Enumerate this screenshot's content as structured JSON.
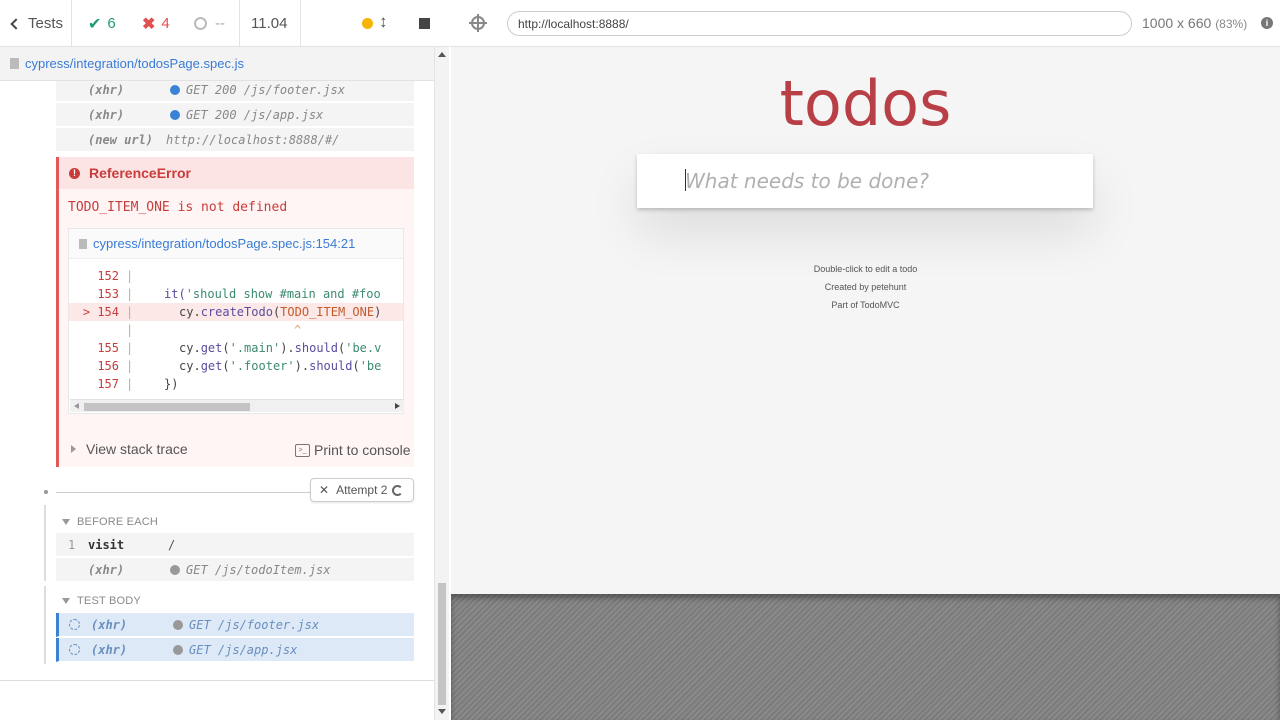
{
  "stats": {
    "back_label": "Tests",
    "passed": "6",
    "failed": "4",
    "pending": "--",
    "duration": "11.04"
  },
  "spec": {
    "path": "cypress/integration/todosPage.spec.js"
  },
  "commands_top": [
    {
      "type": "(xhr)",
      "msg": "GET 200 /js/footer.jsx"
    },
    {
      "type": "(xhr)",
      "msg": "GET 200 /js/app.jsx"
    },
    {
      "type": "(new url)",
      "msg": "http://localhost:8888/#/"
    }
  ],
  "error": {
    "name": "ReferenceError",
    "message": "TODO_ITEM_ONE is not defined",
    "file_link": "cypress/integration/todosPage.spec.js:154:21",
    "lines": {
      "l152": "152",
      "l153": "153",
      "l154": "> 154",
      "l155": "155",
      "l156": "156",
      "l157": "157"
    },
    "code": {
      "l153_a": "it(",
      "l153_b": "'should show #main and #foo",
      "l154_a": "cy.",
      "l154_b": "createTodo",
      "l154_c": "(",
      "l154_d": "TODO_ITEM_ONE",
      "l154_e": ")",
      "caret": "^",
      "l155_a": "cy.",
      "l155_b": "get",
      "l155_c": "(",
      "l155_d": "'.main'",
      "l155_e": ").",
      "l155_f": "should",
      "l155_g": "(",
      "l155_h": "'be.v",
      "l156_a": "cy.",
      "l156_b": "get",
      "l156_c": "(",
      "l156_d": "'.footer'",
      "l156_e": ").",
      "l156_f": "should",
      "l156_g": "(",
      "l156_h": "'be",
      "l157": "})"
    },
    "view_stack_trace": "View stack trace",
    "print_to_console": "Print to console"
  },
  "attempt": {
    "label": "Attempt 2"
  },
  "before_each": {
    "title": "BEFORE EACH",
    "commands": [
      {
        "num": "1",
        "name": "visit",
        "path": "/"
      },
      {
        "type": "(xhr)",
        "msg": "GET /js/todoItem.jsx"
      }
    ]
  },
  "test_body": {
    "title": "TEST BODY",
    "commands": [
      {
        "type": "(xhr)",
        "msg": "GET /js/footer.jsx"
      },
      {
        "type": "(xhr)",
        "msg": "GET /js/app.jsx"
      }
    ]
  },
  "aut": {
    "url": "http://localhost:8888/",
    "viewport": "1000 x 660",
    "scale": "(83%)",
    "title": "todos",
    "placeholder": "What needs to be done?",
    "info": [
      "Double-click to edit a todo",
      "Created by petehunt",
      "Part of TodoMVC"
    ]
  },
  "colors": {
    "passed": "#1e9e6e",
    "failed": "#e05050",
    "todos_red": "#b83f45",
    "link_blue": "#3a7bd5"
  }
}
